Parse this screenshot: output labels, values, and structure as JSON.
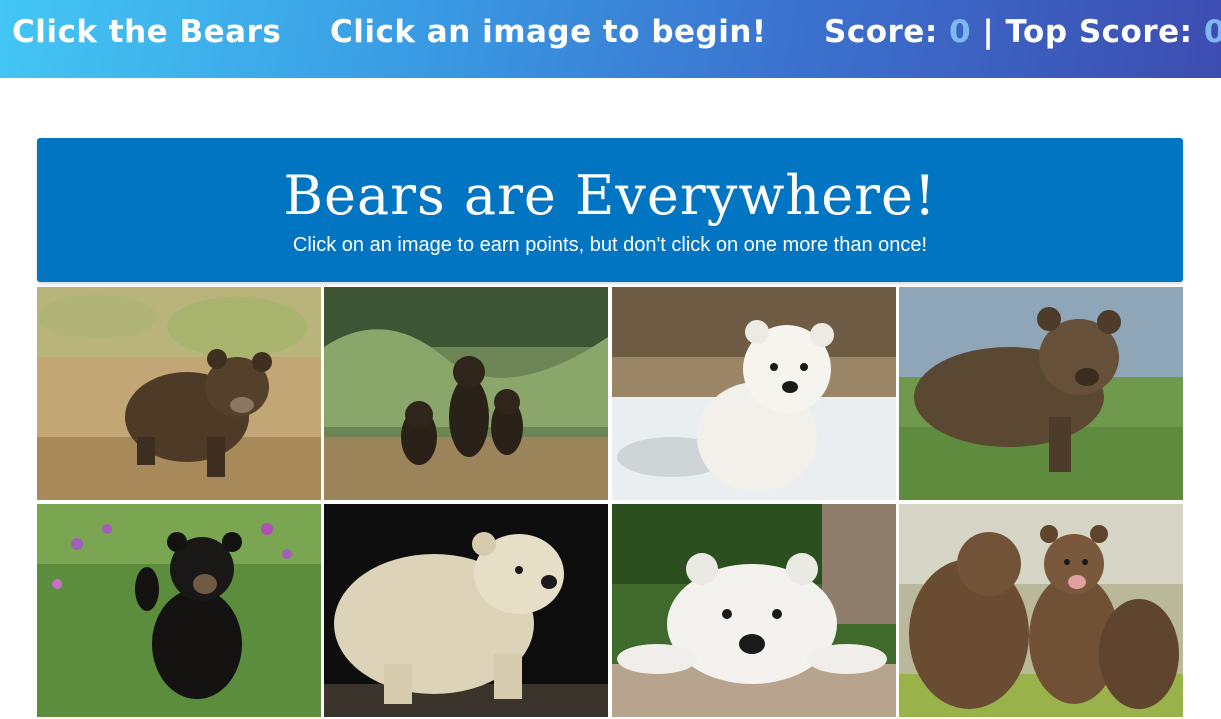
{
  "navbar": {
    "title": "Click the Bears",
    "message": "Click an image to begin!",
    "score_label": "Score: ",
    "score": "0",
    "separator": " | ",
    "top_score_label": "Top Score: ",
    "top_score": "0"
  },
  "jumbotron": {
    "heading": "Bears are Everywhere!",
    "subheading": "Click on an image to earn points, but don't click on one more than once!"
  },
  "cards": [
    {
      "icon": "brown-bear-cub-on-dry-grass-image"
    },
    {
      "icon": "three-bear-cubs-in-grass-image"
    },
    {
      "icon": "polar-bear-cub-in-snow-image"
    },
    {
      "icon": "brown-bear-cub-in-meadow-image"
    },
    {
      "icon": "black-bear-cub-waving-with-flowers-image"
    },
    {
      "icon": "polar-bear-cub-walking-image"
    },
    {
      "icon": "polar-bear-cub-resting-on-rock-image"
    },
    {
      "icon": "grizzly-cubs-playing-image"
    }
  ],
  "colors": {
    "jumbotron": "#0275c2",
    "score_accent": "#7fb8f0"
  }
}
